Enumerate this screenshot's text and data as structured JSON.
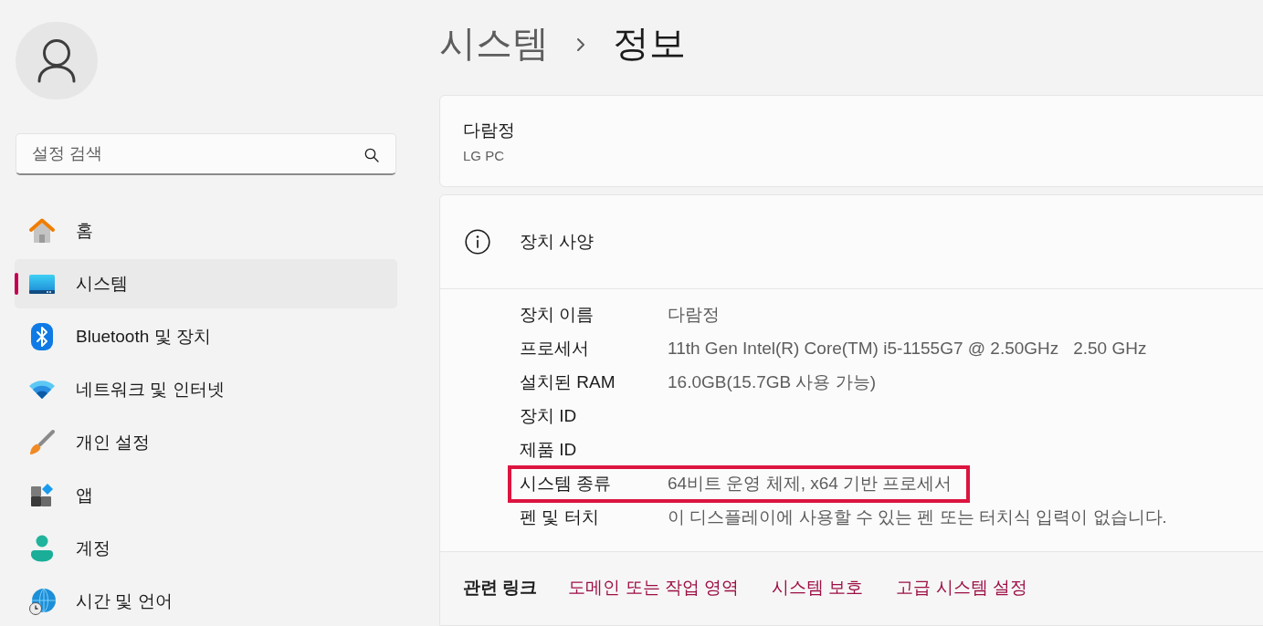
{
  "sidebar": {
    "search": {
      "placeholder": "설정 검색"
    },
    "items": [
      {
        "kind": "home",
        "label": "홈",
        "selected": false
      },
      {
        "kind": "system",
        "label": "시스템",
        "selected": true
      },
      {
        "kind": "bluetooth",
        "label": "Bluetooth 및 장치",
        "selected": false
      },
      {
        "kind": "network",
        "label": "네트워크 및 인터넷",
        "selected": false
      },
      {
        "kind": "personalization",
        "label": "개인 설정",
        "selected": false
      },
      {
        "kind": "apps",
        "label": "앱",
        "selected": false
      },
      {
        "kind": "accounts",
        "label": "계정",
        "selected": false
      },
      {
        "kind": "time",
        "label": "시간 및 언어",
        "selected": false
      }
    ]
  },
  "breadcrumb": [
    {
      "label": "시스템",
      "current": false
    },
    {
      "label": "정보",
      "current": true
    }
  ],
  "device": {
    "name": "다람정",
    "model": "LG PC"
  },
  "specs": {
    "title": "장치 사양",
    "rows": [
      {
        "label": "장치 이름",
        "value": "다람정",
        "highlighted": false
      },
      {
        "label": "프로세서",
        "value": "11th Gen Intel(R) Core(TM) i5-1155G7 @ 2.50GHz   2.50 GHz",
        "highlighted": false
      },
      {
        "label": "설치된 RAM",
        "value": "16.0GB(15.7GB 사용 가능)",
        "highlighted": false
      },
      {
        "label": "장치 ID",
        "highlighted": false
      },
      {
        "label": "제품 ID",
        "highlighted": false
      },
      {
        "label": "시스템 종류",
        "value": "64비트 운영 체제, x64 기반 프로세서",
        "highlighted": true
      },
      {
        "label": "펜 및 터치",
        "value": "이 디스플레이에 사용할 수 있는 펜 또는 터치식 입력이 없습니다.",
        "highlighted": false
      }
    ]
  },
  "related_links": {
    "title": "관련 링크",
    "links": [
      "도메인 또는 작업 영역",
      "시스템 보호",
      "고급 시스템 설정"
    ]
  }
}
